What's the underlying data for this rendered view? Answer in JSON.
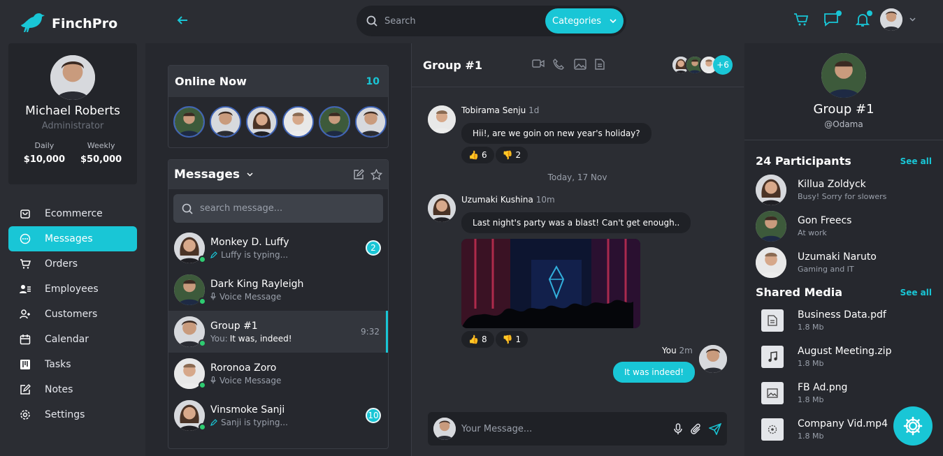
{
  "app": {
    "name": "FinchPro"
  },
  "search": {
    "placeholder": "Search",
    "category_label": "Categories"
  },
  "profile": {
    "name": "Michael Roberts",
    "role": "Administrator",
    "daily_label": "Daily",
    "daily_value": "$10,000",
    "weekly_label": "Weekly",
    "weekly_value": "$50,000"
  },
  "nav": [
    {
      "label": "Ecommerce",
      "icon": "bag-icon"
    },
    {
      "label": "Messages",
      "icon": "chat-icon",
      "active": true
    },
    {
      "label": "Orders",
      "icon": "cart-icon"
    },
    {
      "label": "Employees",
      "icon": "employee-icon"
    },
    {
      "label": "Customers",
      "icon": "customers-icon"
    },
    {
      "label": "Calendar",
      "icon": "calendar-icon"
    },
    {
      "label": "Tasks",
      "icon": "tasks-icon"
    },
    {
      "label": "Notes",
      "icon": "notes-icon"
    },
    {
      "label": "Settings",
      "icon": "gear-icon"
    }
  ],
  "online": {
    "title": "Online Now",
    "count": "10"
  },
  "messages": {
    "title": "Messages",
    "search_placeholder": "search message...",
    "conversations": [
      {
        "name": "Monkey D. Luffy",
        "status": "Luffy is typing...",
        "badge": "2"
      },
      {
        "name": "Dark King Rayleigh",
        "status": "Voice Message"
      },
      {
        "name": "Group #1",
        "status_prefix": "You:",
        "status": "It was, indeed!",
        "time": "9:32"
      },
      {
        "name": "Roronoa Zoro",
        "status": "Voice Message"
      },
      {
        "name": "Vinsmoke Sanji",
        "status": "Sanji is typing...",
        "badge": "10"
      }
    ]
  },
  "chat": {
    "title": "Group #1",
    "extra_members": "+6",
    "msg1": {
      "sender": "Tobirama Senju",
      "time": "1d",
      "text": "Hii!, are we goin on new year's holiday?",
      "up": "6",
      "down": "2"
    },
    "date_divider": "Today, 17 Nov",
    "msg2": {
      "sender": "Uzumaki Kushina",
      "time": "10m",
      "text": "Last night's party was a blast! Can't get enough..",
      "up": "8",
      "down": "1"
    },
    "msg3": {
      "sender": "You",
      "time": "2m",
      "text": "It was indeed!"
    },
    "composer_placeholder": "Your Message..."
  },
  "details": {
    "name": "Group #1",
    "handle": "@Odama",
    "participants_title": "24 Participants",
    "see_all": "See all",
    "participants": [
      {
        "name": "Killua Zoldyck",
        "status": "Busy! Sorry for slowers"
      },
      {
        "name": "Gon Freecs",
        "status": "At work"
      },
      {
        "name": "Uzumaki Naruto",
        "status": "Gaming and IT"
      }
    ],
    "media_title": "Shared Media",
    "files": [
      {
        "name": "Business Data.pdf",
        "size": "1.8 Mb",
        "icon": "document-icon"
      },
      {
        "name": "August Meeting.zip",
        "size": "1.8 Mb",
        "icon": "music-icon"
      },
      {
        "name": "FB Ad.png",
        "size": "1.8 Mb",
        "icon": "image-icon"
      },
      {
        "name": "Company Vid.mp4",
        "size": "1.8 Mb",
        "icon": "video-icon"
      }
    ]
  },
  "colors": {
    "accent": "#19c6d6",
    "background": "#2b2d33",
    "panel": "#26282e",
    "online": "#2ecc71"
  }
}
